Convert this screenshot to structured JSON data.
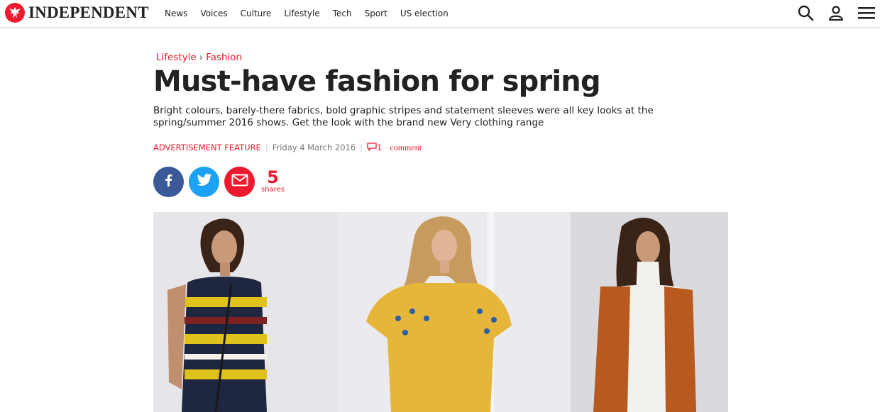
{
  "header": {
    "logo_text": "INDEPENDENT",
    "nav": [
      "News",
      "Voices",
      "Culture",
      "Lifestyle",
      "Tech",
      "Sport",
      "US election"
    ],
    "icons": [
      "search-icon",
      "user-icon",
      "menu-icon"
    ]
  },
  "article": {
    "breadcrumb": [
      "Lifestyle",
      "Fashion"
    ],
    "breadcrumb_separator": "›",
    "title": "Must-have fashion for spring",
    "standfirst": "Bright colours, barely-there fabrics, bold graphic stripes and statement sleeves were all key looks at the spring/summer 2016 shows. Get the look with the brand new Very clothing range",
    "meta": {
      "label": "ADVERTISEMENT FEATURE",
      "date": "Friday 4 March 2016",
      "comment_count": "1",
      "comment_word": "comment"
    },
    "share": {
      "count": "5",
      "count_label": "shares",
      "buttons": [
        "facebook-icon",
        "twitter-icon",
        "email-icon"
      ]
    }
  },
  "colors": {
    "brand_red": "#ec1a2e",
    "facebook": "#3b5998",
    "twitter": "#1da1f2"
  }
}
